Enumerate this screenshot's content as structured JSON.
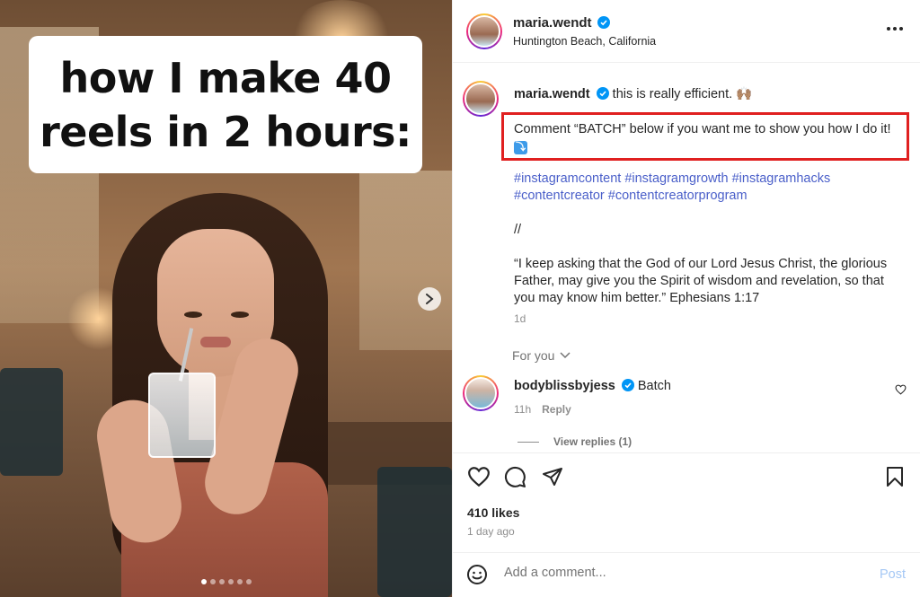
{
  "media": {
    "headline_line1": "how I make 40",
    "headline_line2": "reels in 2 hours:",
    "slide_count": 6,
    "active_slide": 1
  },
  "header": {
    "username": "maria.wendt",
    "location": "Huntington Beach, California"
  },
  "caption": {
    "username": "maria.wendt",
    "text": "this is really efficient. 🙌🏽",
    "cta": "Comment “BATCH” below if you want me to show you how I do it!",
    "cta_emoji": "⤵",
    "hashtags": [
      "#instagramcontent",
      "#instagramgrowth",
      "#instagramhacks",
      "#contentcreator",
      "#contentcreatorprogram"
    ],
    "separator": "//",
    "verse": "“I keep asking that the God of our Lord Jesus Christ, the glorious Father, may give you the Spirit of wisdom and revelation, so that you may know him better.” Ephesians 1:17",
    "time": "1d"
  },
  "for_you": "For you",
  "comments": [
    {
      "username": "bodyblissbyjess",
      "text": "Batch",
      "time": "11h",
      "reply_label": "Reply",
      "view_replies": "View replies (1)"
    }
  ],
  "stats": {
    "likes": "410 likes",
    "ago": "1 day ago"
  },
  "composer": {
    "placeholder": "Add a comment...",
    "post_label": "Post"
  },
  "colors": {
    "verified": "#0095f6",
    "highlight_border": "#e02020",
    "hashtag": "#4a5fc9",
    "post_disabled": "#a5c8f5"
  }
}
